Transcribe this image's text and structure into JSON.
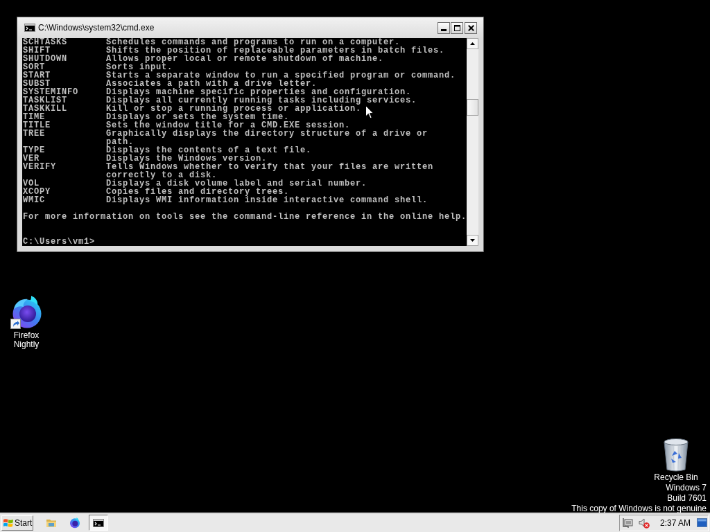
{
  "window": {
    "title": "C:\\Windows\\system32\\cmd.exe"
  },
  "console": {
    "entries": [
      {
        "command": "SCHTASKS",
        "lines": [
          "Schedules commands and programs to run on a computer."
        ]
      },
      {
        "command": "SHIFT",
        "lines": [
          "Shifts the position of replaceable parameters in batch files."
        ]
      },
      {
        "command": "SHUTDOWN",
        "lines": [
          "Allows proper local or remote shutdown of machine."
        ]
      },
      {
        "command": "SORT",
        "lines": [
          "Sorts input."
        ]
      },
      {
        "command": "START",
        "lines": [
          "Starts a separate window to run a specified program or command."
        ]
      },
      {
        "command": "SUBST",
        "lines": [
          "Associates a path with a drive letter."
        ]
      },
      {
        "command": "SYSTEMINFO",
        "lines": [
          "Displays machine specific properties and configuration."
        ]
      },
      {
        "command": "TASKLIST",
        "lines": [
          "Displays all currently running tasks including services."
        ]
      },
      {
        "command": "TASKKILL",
        "lines": [
          "Kill or stop a running process or application."
        ]
      },
      {
        "command": "TIME",
        "lines": [
          "Displays or sets the system time."
        ]
      },
      {
        "command": "TITLE",
        "lines": [
          "Sets the window title for a CMD.EXE session."
        ]
      },
      {
        "command": "TREE",
        "lines": [
          "Graphically displays the directory structure of a drive or",
          "path."
        ]
      },
      {
        "command": "TYPE",
        "lines": [
          "Displays the contents of a text file."
        ]
      },
      {
        "command": "VER",
        "lines": [
          "Displays the Windows version."
        ]
      },
      {
        "command": "VERIFY",
        "lines": [
          "Tells Windows whether to verify that your files are written",
          "correctly to a disk."
        ]
      },
      {
        "command": "VOL",
        "lines": [
          "Displays a disk volume label and serial number."
        ]
      },
      {
        "command": "XCOPY",
        "lines": [
          "Copies files and directory trees."
        ]
      },
      {
        "command": "WMIC",
        "lines": [
          "Displays WMI information inside interactive command shell."
        ]
      }
    ],
    "footer": "For more information on tools see the command-line reference in the online help.",
    "prompt": "C:\\Users\\vm1>"
  },
  "desktop_icons": [
    {
      "label": "Firefox Nightly",
      "kind": "browser",
      "shortcut": true
    },
    {
      "label": "Recycle Bin",
      "kind": "recycle_bin",
      "shortcut": false
    }
  ],
  "desktop_notice": [
    "Windows 7",
    "Build 7601",
    "This copy of Windows is not genuine"
  ],
  "taskbar": {
    "start_label": "Start",
    "items": [
      {
        "kind": "folder",
        "selected": false
      },
      {
        "kind": "browser",
        "selected": false
      },
      {
        "kind": "console",
        "selected": true
      }
    ],
    "clock": "2:37 AM"
  }
}
